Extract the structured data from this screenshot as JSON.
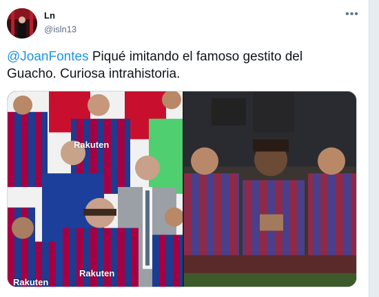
{
  "tweet": {
    "author_name": "Ln",
    "author_handle": "@isln13",
    "mention": "@JoanFontes",
    "body": "Piqué imitando el famoso gestito del Guacho. Curiosa intrahistoria."
  },
  "media": {
    "left_sponsor_text": "Rakuten",
    "left_sponsor_text_2": "Rakuten",
    "left_sponsor_text_3": "Rakuten"
  },
  "icons": {
    "more": "more-options-icon"
  },
  "colors": {
    "link": "#1b95e0",
    "text": "#0f1419",
    "secondary": "#5b7083",
    "barca_blue": "#1d3b8f",
    "barca_red": "#a50044"
  }
}
